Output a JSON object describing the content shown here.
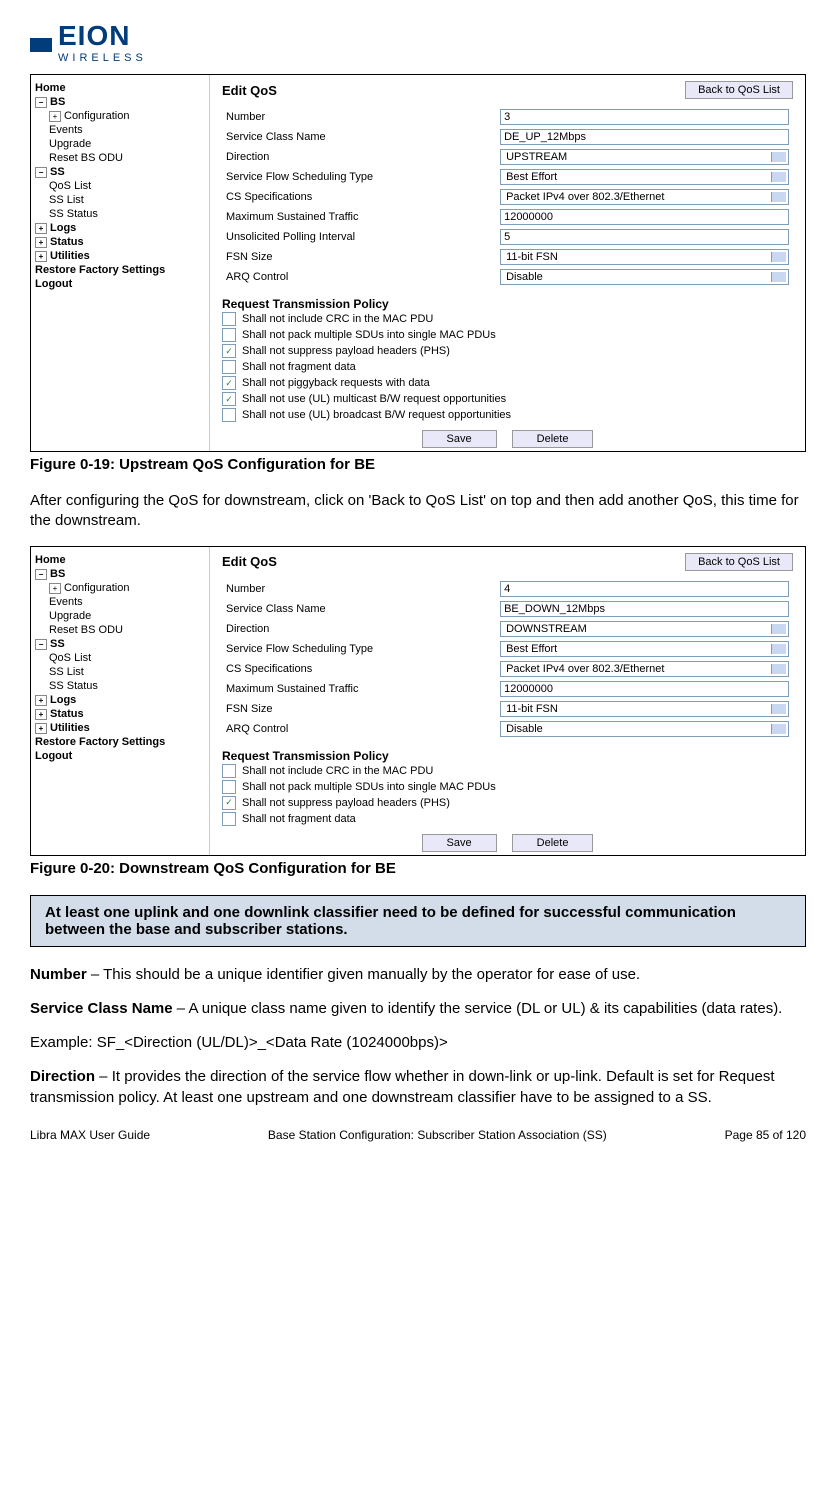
{
  "logo": {
    "brand": "EION",
    "subtitle": "WIRELESS"
  },
  "nav": {
    "home": "Home",
    "bs": "BS",
    "bs_config": "Configuration",
    "bs_events": "Events",
    "bs_upgrade": "Upgrade",
    "bs_reset": "Reset BS ODU",
    "ss": "SS",
    "ss_qos": "QoS List",
    "ss_list": "SS List",
    "ss_status": "SS Status",
    "logs": "Logs",
    "status": "Status",
    "utilities": "Utilities",
    "restore": "Restore Factory Settings",
    "logout": "Logout"
  },
  "fig1": {
    "title": "Edit QoS",
    "back": "Back to QoS List",
    "rows": {
      "number_l": "Number",
      "number_v": "3",
      "scn_l": "Service Class Name",
      "scn_v": "DE_UP_12Mbps",
      "dir_l": "Direction",
      "dir_v": "UPSTREAM",
      "sfs_l": "Service Flow Scheduling Type",
      "sfs_v": "Best Effort",
      "cs_l": "CS Specifications",
      "cs_v": "Packet IPv4 over 802.3/Ethernet",
      "mst_l": "Maximum Sustained Traffic",
      "mst_v": "12000000",
      "upi_l": "Unsolicited Polling Interval",
      "upi_v": "5",
      "fsn_l": "FSN Size",
      "fsn_v": "11-bit FSN",
      "arq_l": "ARQ Control",
      "arq_v": "Disable"
    },
    "policy_title": "Request Transmission Policy",
    "policy": {
      "p1": "Shall not include CRC in the MAC PDU",
      "p2": "Shall not pack multiple SDUs into single MAC PDUs",
      "p3": "Shall not suppress payload headers (PHS)",
      "p4": "Shall not fragment data",
      "p5": "Shall not piggyback requests with data",
      "p6": "Shall not use (UL) multicast B/W request opportunities",
      "p7": "Shall not use (UL) broadcast B/W request opportunities"
    },
    "save": "Save",
    "delete": "Delete"
  },
  "caption1": "Figure 0-19: Upstream QoS Configuration for BE",
  "para1": "After configuring the QoS for downstream, click on 'Back to QoS List' on top and then add another QoS, this time for the downstream.",
  "fig2": {
    "title": "Edit QoS",
    "back": "Back to QoS List",
    "rows": {
      "number_l": "Number",
      "number_v": "4",
      "scn_l": "Service Class Name",
      "scn_v": "BE_DOWN_12Mbps",
      "dir_l": "Direction",
      "dir_v": "DOWNSTREAM",
      "sfs_l": "Service Flow Scheduling Type",
      "sfs_v": "Best Effort",
      "cs_l": "CS Specifications",
      "cs_v": "Packet IPv4 over 802.3/Ethernet",
      "mst_l": "Maximum Sustained Traffic",
      "mst_v": "12000000",
      "fsn_l": "FSN Size",
      "fsn_v": "11-bit FSN",
      "arq_l": "ARQ Control",
      "arq_v": "Disable"
    },
    "policy_title": "Request Transmission Policy",
    "policy": {
      "p1": "Shall not include CRC in the MAC PDU",
      "p2": "Shall not pack multiple SDUs into single MAC PDUs",
      "p3": "Shall not suppress payload headers (PHS)",
      "p4": "Shall not fragment data"
    },
    "save": "Save",
    "delete": "Delete"
  },
  "caption2": "Figure 0-20: Downstream QoS Configuration for BE",
  "note": "At least one uplink and one downlink classifier need to be defined for successful communication between the base and subscriber stations.",
  "defs": {
    "number_t": "Number",
    "number_d": " – This should be a unique identifier given manually by the operator for ease of use.",
    "scn_t": "Service Class Name",
    "scn_d": " – A unique class name given to identify the service  (DL or UL) & its capabilities (data rates).",
    "example": "Example: SF_<Direction (UL/DL)>_<Data Rate (1024000bps)>",
    "dir_t": "Direction",
    "dir_d": " – It provides the direction of the service flow whether in down-link or up-link. Default is set for Request transmission policy. At least one upstream and one downstream classifier have to be assigned to a SS."
  },
  "footer": {
    "left": "Libra MAX User Guide",
    "center": "Base Station Configuration: Subscriber Station Association (SS)",
    "right": "Page 85 of 120"
  }
}
